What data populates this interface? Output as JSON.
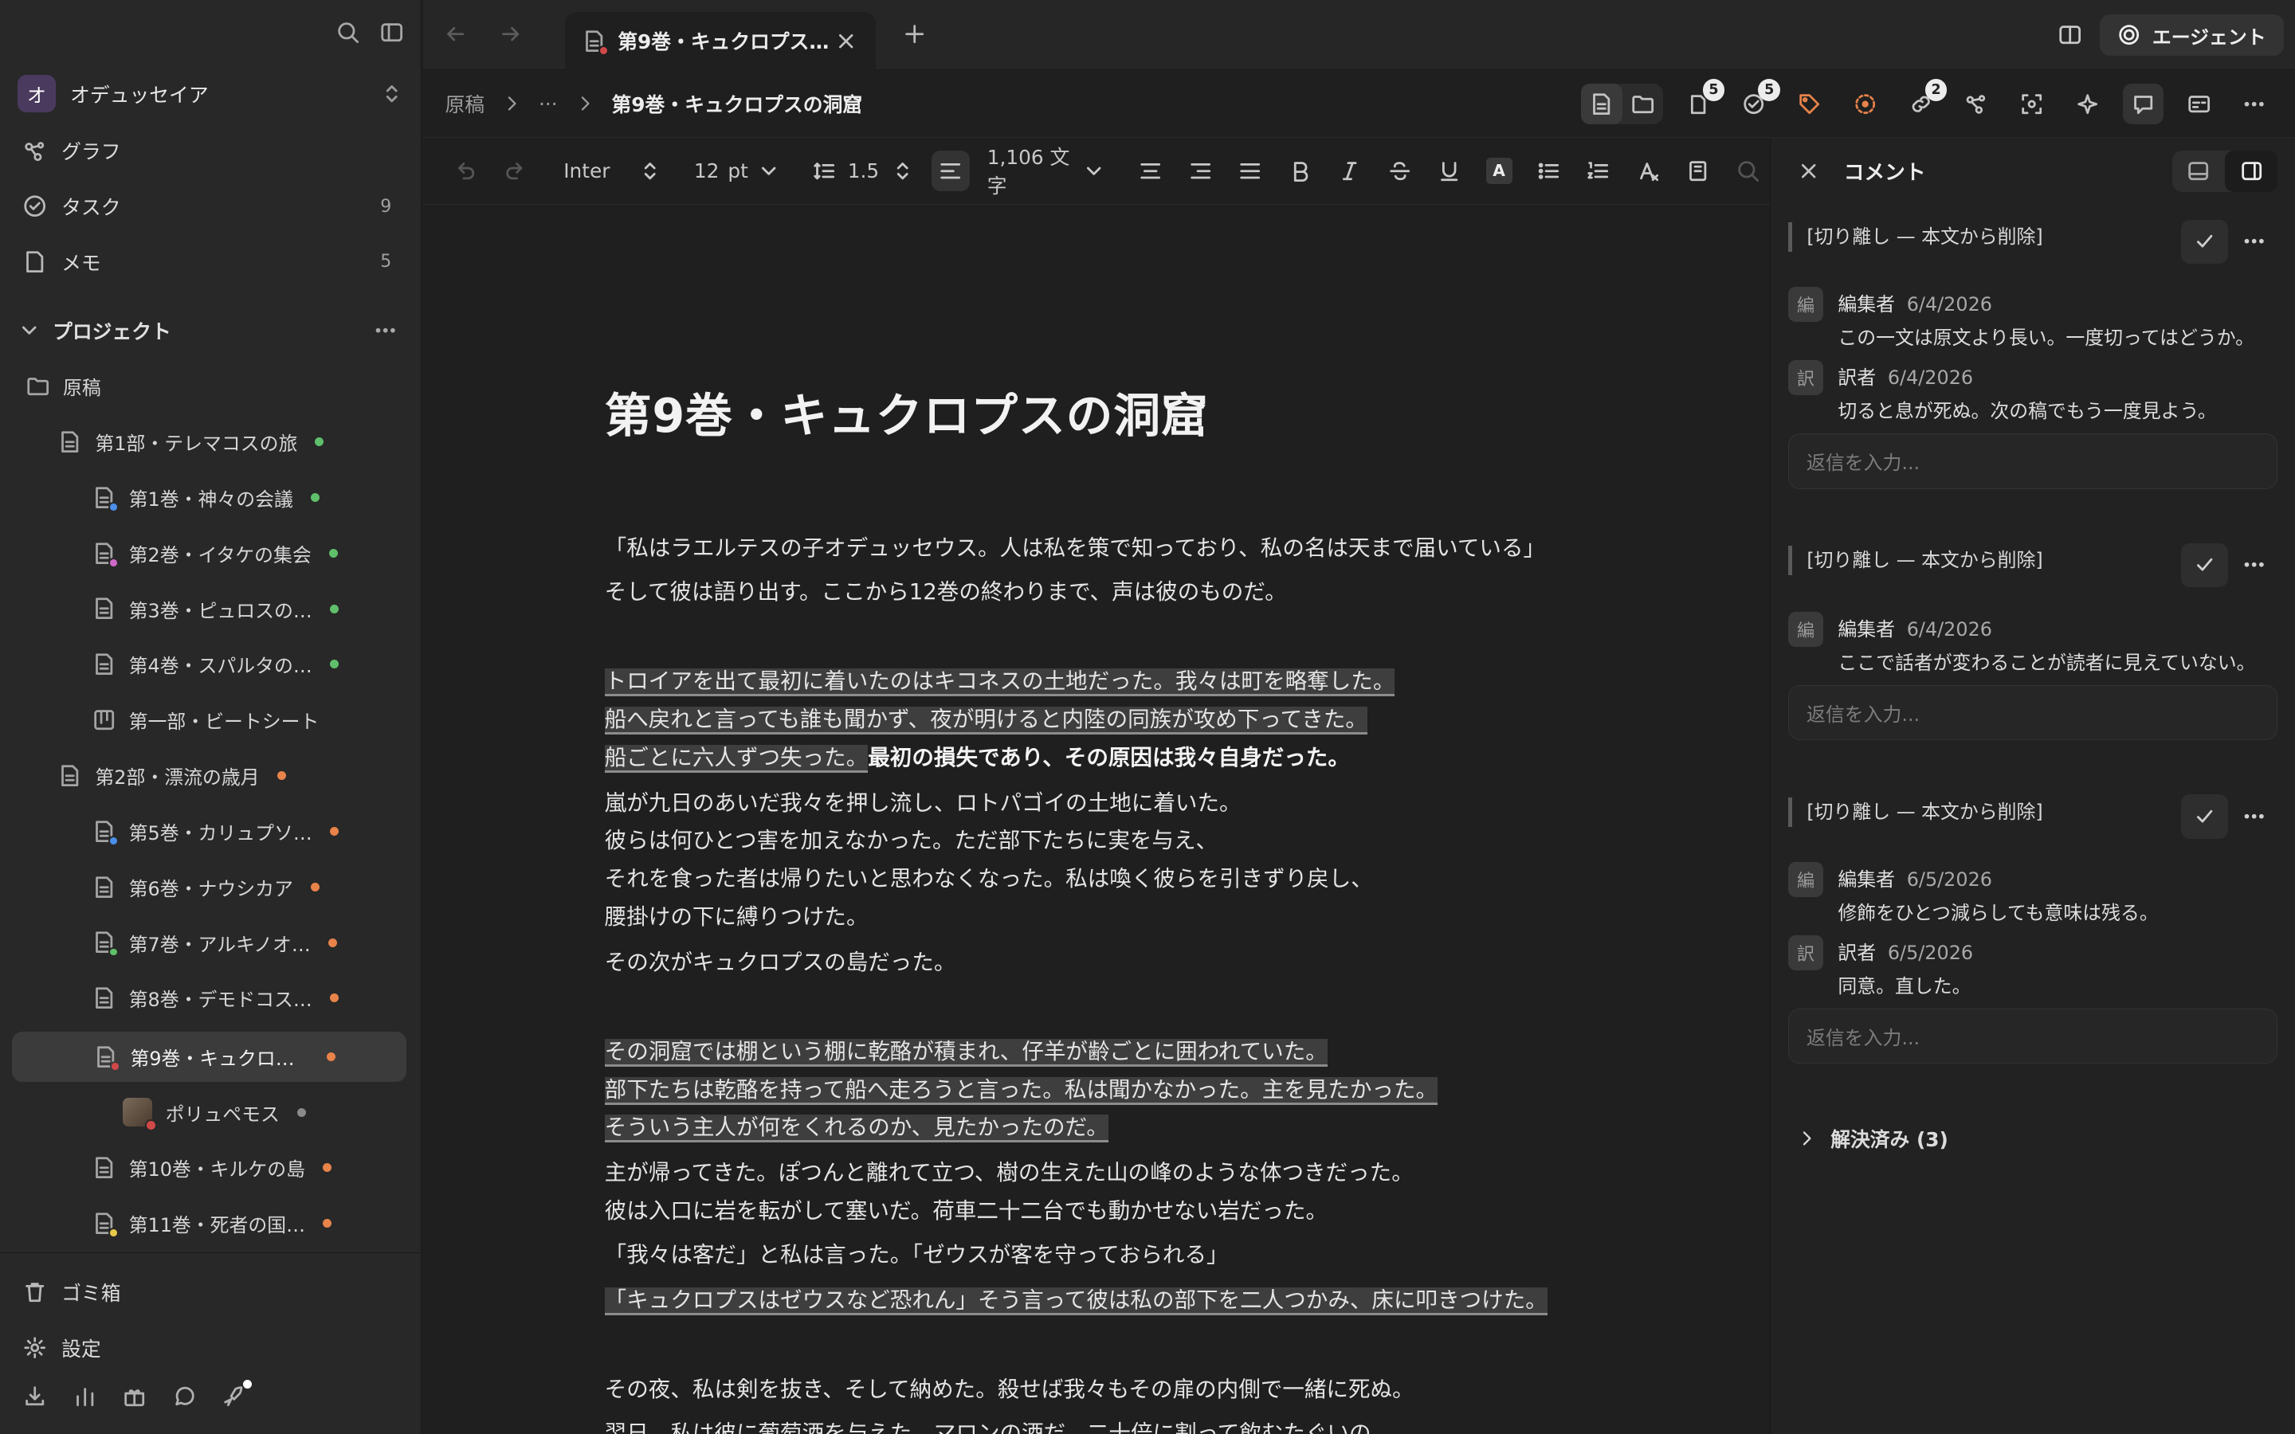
{
  "sidebar": {
    "workspace": {
      "initial": "オ",
      "name": "オデュッセイア"
    },
    "nav": [
      {
        "label": "グラフ",
        "count": ""
      },
      {
        "label": "タスク",
        "count": "9"
      },
      {
        "label": "メモ",
        "count": "5"
      }
    ],
    "section_title": "プロジェクト",
    "tree": [
      {
        "label": "原稿"
      },
      {
        "label": "第1部・テレマコスの旅"
      },
      {
        "label": "第1巻・神々の会議"
      },
      {
        "label": "第2巻・イタケの集会"
      },
      {
        "label": "第3巻・ピュロスの…"
      },
      {
        "label": "第4巻・スパルタの…"
      },
      {
        "label": "第一部・ビートシート"
      },
      {
        "label": "第2部・漂流の歳月"
      },
      {
        "label": "第5巻・カリュプソ…"
      },
      {
        "label": "第6巻・ナウシカア"
      },
      {
        "label": "第7巻・アルキノオ…"
      },
      {
        "label": "第8巻・デモドコス…"
      },
      {
        "label": "第9巻・キュクロ…"
      },
      {
        "label": "ポリュペモス"
      },
      {
        "label": "第10巻・キルケの島"
      },
      {
        "label": "第11巻・死者の国…"
      }
    ],
    "trash": "ゴミ箱",
    "settings": "設定"
  },
  "tab": {
    "title": "第9巻・キュクロプス…"
  },
  "agent_label": "エージェント",
  "breadcrumb": {
    "root": "原稿",
    "ellipsis": "···",
    "current": "第9巻・キュクロプスの洞窟"
  },
  "badges": {
    "files": "5",
    "tasks": "5",
    "links": "2"
  },
  "toolbar": {
    "font": "Inter",
    "size": "12",
    "unit": "pt",
    "line_height": "1.5",
    "word_count": "1,106 文字"
  },
  "document": {
    "title": "第9巻・キュクロプスの洞窟",
    "lines": [
      "「私はラエルテスの子オデュッセウス。人は私を策で知っており、私の名は天まで届いている」",
      "そして彼は語り出す。ここから12巻の終わりまで、声は彼のものだ。",
      "トロイアを出て最初に着いたのはキコネスの土地だった。我々は町を略奪した。",
      "船へ戻れと言っても誰も聞かず、夜が明けると内陸の同族が攻め下ってきた。",
      "船ごとに六人ずつ失った。",
      "最初の損失であり、その原因は我々自身だった。",
      "嵐が九日のあいだ我々を押し流し、ロトパゴイの土地に着いた。",
      "彼らは何ひとつ害を加えなかった。ただ部下たちに実を与え、",
      "それを食った者は帰りたいと思わなくなった。私は喚く彼らを引きずり戻し、",
      "腰掛けの下に縛りつけた。",
      "その次がキュクロプスの島だった。",
      "その洞窟では棚という棚に乾酪が積まれ、仔羊が齢ごとに囲われていた。",
      "部下たちは乾酪を持って船へ走ろうと言った。私は聞かなかった。主を見たかった。",
      "そういう主人が何をくれるのか、見たかったのだ。",
      "主が帰ってきた。ぽつんと離れて立つ、樹の生えた山の峰のような体つきだった。",
      "彼は入口に岩を転がして塞いだ。荷車二十二台でも動かせない岩だった。",
      "「我々は客だ」と私は言った。「ゼウスが客を守っておられる」",
      "「キュクロプスはゼウスなど恐れん」そう言って彼は私の部下を二人つかみ、床に叩きつけた。",
      "その夜、私は剣を抜き、そして納めた。殺せば我々もその扉の内側で一緒に死ぬ。",
      "翌日、私は彼に葡萄酒を与えた。マロンの酒だ。二十倍に割って飲むたぐいの。"
    ]
  },
  "comments": {
    "title": "コメント",
    "threads": [
      {
        "quote": "[切り離し — 本文から削除]",
        "items": [
          {
            "avatar": "編",
            "author": "編集者",
            "date": "6/4/2026",
            "text": "この一文は原文より長い。一度切ってはどうか。"
          },
          {
            "avatar": "訳",
            "author": "訳者",
            "date": "6/4/2026",
            "text": "切ると息が死ぬ。次の稿でもう一度見よう。"
          }
        ],
        "reply_placeholder": "返信を入力..."
      },
      {
        "quote": "[切り離し — 本文から削除]",
        "items": [
          {
            "avatar": "編",
            "author": "編集者",
            "date": "6/4/2026",
            "text": "ここで話者が変わることが読者に見えていない。"
          }
        ],
        "reply_placeholder": "返信を入力..."
      },
      {
        "quote": "[切り離し — 本文から削除]",
        "items": [
          {
            "avatar": "編",
            "author": "編集者",
            "date": "6/5/2026",
            "text": "修飾をひとつ減らしても意味は残る。"
          },
          {
            "avatar": "訳",
            "author": "訳者",
            "date": "6/5/2026",
            "text": "同意。直した。"
          }
        ],
        "reply_placeholder": "返信を入力..."
      }
    ],
    "resolved_label": "解決済み (3)"
  },
  "colors": {
    "green": "#5fbf6a",
    "orange": "#e8834a",
    "blue": "#4a8fe8",
    "pink": "#d068c8",
    "red": "#d04848",
    "yellow": "#e8c84a",
    "gray": "#8a8a8a"
  }
}
